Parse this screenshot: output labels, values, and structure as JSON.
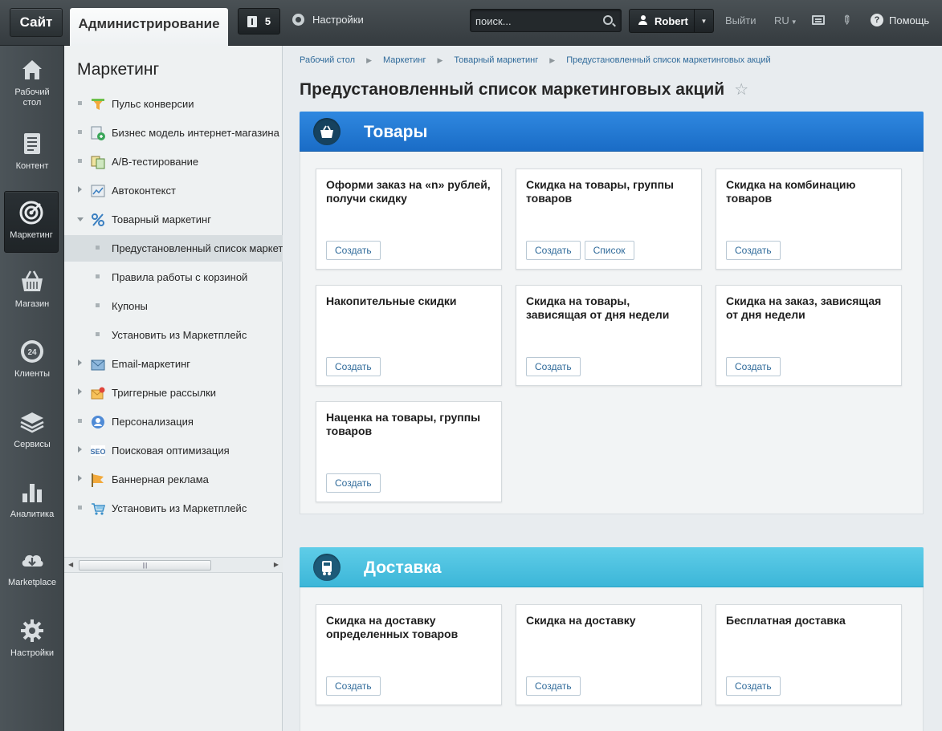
{
  "topbar": {
    "site_label": "Сайт",
    "admin_tab_label": "Администрирование",
    "notifications_count": "5",
    "settings_label": "Настройки",
    "search_placeholder": "поиск...",
    "user_name": "Robert",
    "logout_label": "Выйти",
    "language_label": "RU",
    "help_label": "Помощь"
  },
  "rail": {
    "items": [
      {
        "label": "Рабочий стол",
        "icon": "home-icon"
      },
      {
        "label": "Контент",
        "icon": "document-icon"
      },
      {
        "label": "Маркетинг",
        "icon": "target-icon"
      },
      {
        "label": "Магазин",
        "icon": "basket-icon"
      },
      {
        "label": "Клиенты",
        "icon": "clock-24-icon"
      },
      {
        "label": "Сервисы",
        "icon": "layers-icon"
      },
      {
        "label": "Аналитика",
        "icon": "bar-chart-icon"
      },
      {
        "label": "Marketplace",
        "icon": "cloud-download-icon"
      },
      {
        "label": "Настройки",
        "icon": "gear-icon"
      }
    ],
    "active_index": 2
  },
  "menu": {
    "title": "Маркетинг",
    "items": [
      {
        "label": "Пульс конверсии",
        "icon": "funnel-icon",
        "marker": "dot"
      },
      {
        "label": "Бизнес модель интернет-магазина",
        "icon": "business-model-icon",
        "marker": "dot"
      },
      {
        "label": "A/B-тестирование",
        "icon": "ab-test-icon",
        "marker": "dot"
      },
      {
        "label": "Автоконтекст",
        "icon": "autocontext-icon",
        "marker": "arrow"
      },
      {
        "label": "Товарный маркетинг",
        "icon": "percent-icon",
        "marker": "arrow-down"
      },
      {
        "label": "Предустановленный список маркет",
        "sub": true,
        "selected": true
      },
      {
        "label": "Правила работы с корзиной",
        "sub": true
      },
      {
        "label": "Купоны",
        "sub": true
      },
      {
        "label": "Установить из Маркетплейс",
        "sub": true
      },
      {
        "label": "Email-маркетинг",
        "icon": "email-icon",
        "marker": "arrow"
      },
      {
        "label": "Триггерные рассылки",
        "icon": "trigger-mail-icon",
        "marker": "arrow"
      },
      {
        "label": "Персонализация",
        "icon": "personalization-icon",
        "marker": "dot"
      },
      {
        "label": "Поисковая оптимизация",
        "icon": "seo-icon",
        "marker": "arrow"
      },
      {
        "label": "Баннерная реклама",
        "icon": "banner-flag-icon",
        "marker": "arrow"
      },
      {
        "label": "Установить из Маркетплейс",
        "icon": "cart-icon",
        "marker": "dot"
      }
    ]
  },
  "breadcrumb": [
    "Рабочий стол",
    "Маркетинг",
    "Товарный маркетинг",
    "Предустановленный список маркетинговых акций"
  ],
  "page_title": "Предустановленный список маркетинговых акций",
  "sections": [
    {
      "title": "Товары",
      "icon": "basket-icon",
      "color": "#2478d4",
      "cards": [
        {
          "title": "Оформи заказ на «n» рублей, получи скидку",
          "buttons": [
            "Создать"
          ]
        },
        {
          "title": "Скидка на товары, группы товаров",
          "buttons": [
            "Создать",
            "Список"
          ]
        },
        {
          "title": "Скидка на комбинацию товаров",
          "buttons": [
            "Создать"
          ]
        },
        {
          "title": "Накопительные скидки",
          "buttons": [
            "Создать"
          ]
        },
        {
          "title": "Скидка на товары, зависящая от дня недели",
          "buttons": [
            "Создать"
          ]
        },
        {
          "title": "Скидка на заказ, зависящая от дня недели",
          "buttons": [
            "Создать"
          ]
        },
        {
          "title": "Наценка на товары, группы товаров",
          "buttons": [
            "Создать"
          ]
        }
      ]
    },
    {
      "title": "Доставка",
      "icon": "truck-icon",
      "color": "#4cc2e0",
      "cards": [
        {
          "title": "Скидка на доставку определенных товаров",
          "buttons": [
            "Создать"
          ]
        },
        {
          "title": "Скидка на доставку",
          "buttons": [
            "Создать"
          ]
        },
        {
          "title": "Бесплатная доставка",
          "buttons": [
            "Создать"
          ]
        }
      ]
    }
  ]
}
